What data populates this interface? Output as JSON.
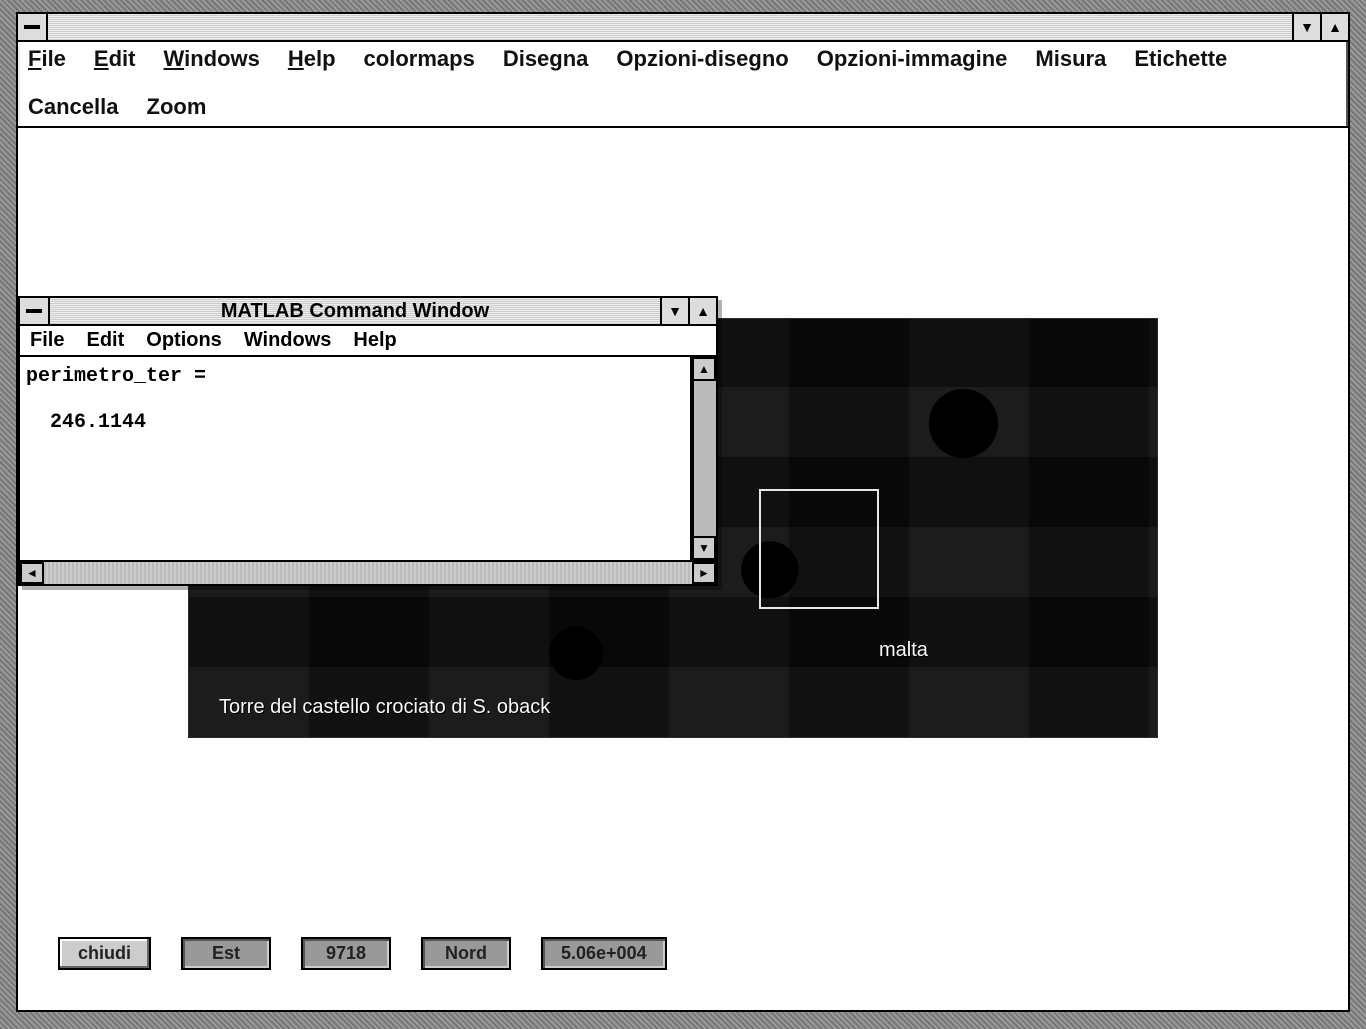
{
  "main_window": {
    "menu": {
      "items": [
        {
          "label": "File",
          "accel": "F"
        },
        {
          "label": "Edit",
          "accel": "E"
        },
        {
          "label": "Windows",
          "accel": "W"
        },
        {
          "label": "Help",
          "accel": "H"
        },
        {
          "label": "colormaps"
        },
        {
          "label": "Disegna"
        },
        {
          "label": "Opzioni-disegno"
        },
        {
          "label": "Opzioni-immagine"
        },
        {
          "label": "Misura"
        },
        {
          "label": "Etichette"
        },
        {
          "label": "Cancella"
        },
        {
          "label": "Zoom"
        }
      ]
    },
    "image": {
      "label_malta": "malta",
      "label_torre": "Torre del castello crociato di S. oback"
    },
    "bottom": {
      "close_btn": "chiudi",
      "fields": [
        {
          "label": "Est"
        },
        {
          "value": "9718"
        },
        {
          "label": "Nord"
        },
        {
          "value": "5.06e+004"
        }
      ]
    }
  },
  "matlab_window": {
    "title": "MATLAB Command Window",
    "menu": {
      "items": [
        {
          "label": "File",
          "accel": "F"
        },
        {
          "label": "Edit",
          "accel": "E"
        },
        {
          "label": "Options",
          "accel": "O"
        },
        {
          "label": "Windows",
          "accel": "W"
        },
        {
          "label": "Help",
          "accel": "H"
        }
      ]
    },
    "output_var": "perimetro_ter =",
    "output_val": "  246.1144"
  }
}
